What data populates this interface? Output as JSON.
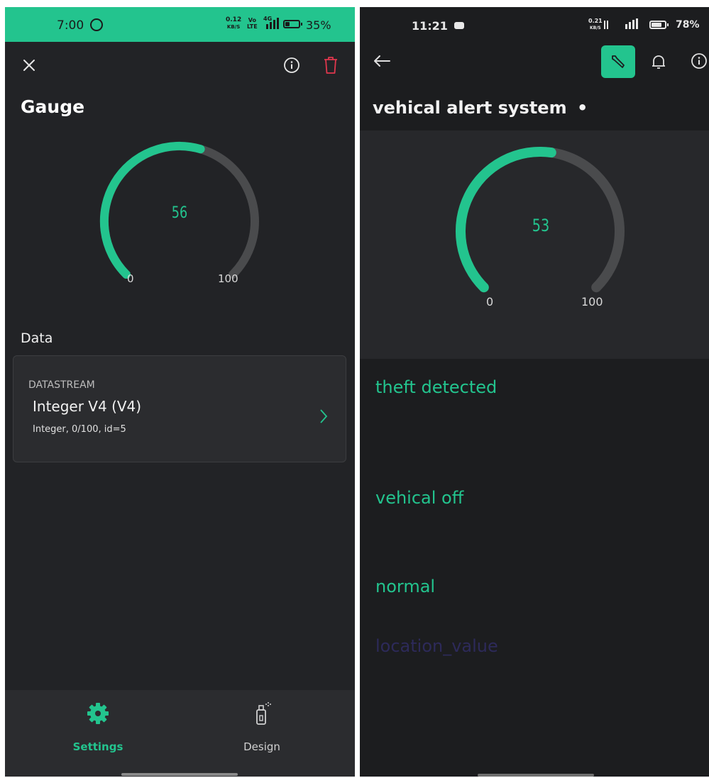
{
  "colors": {
    "accent": "#23c48e",
    "track": "#4a4b4d",
    "status_bar_left": "#23c48e",
    "panel_bg": "#222326",
    "delete_red": "#e0374d",
    "faded_text": "#2d2a5a"
  },
  "left": {
    "status_bar": {
      "time": "7:00",
      "speed_top": "0.12",
      "speed_bottom": "KB/S",
      "net_top": "Vo",
      "net_bottom": "LTE",
      "net2": "4G",
      "battery": "35%",
      "battery_level": 0.35
    },
    "header": {
      "close_icon": "close-icon",
      "info_icon": "info-icon",
      "delete_icon": "trash-icon"
    },
    "title": "Gauge",
    "gauge": {
      "value": 56,
      "min": 0,
      "max": 100,
      "value_text": "56",
      "min_label": "0",
      "max_label": "100"
    },
    "section_title": "Data",
    "datastream": {
      "label": "DATASTREAM",
      "name": "Integer V4 (V4)",
      "details": "Integer, 0/100, id=5"
    },
    "bottom_nav": [
      {
        "label": "Settings",
        "icon": "gear-icon",
        "active": true
      },
      {
        "label": "Design",
        "icon": "spray-can-icon",
        "active": false
      }
    ]
  },
  "right": {
    "status_bar": {
      "time": "11:21",
      "speed_top": "0.21",
      "speed_bottom": "KB/S",
      "battery": "78%",
      "battery_level": 0.78
    },
    "header": {
      "back_icon": "arrow-left-icon",
      "wrench_icon": "wrench-icon",
      "bell_icon": "bell-icon",
      "info_icon": "info-icon"
    },
    "title": "vehical alert system",
    "title_dot": "•",
    "gauge": {
      "value": 53,
      "min": 0,
      "max": 100,
      "value_text": "53",
      "min_label": "0",
      "max_label": "100"
    },
    "labels": [
      "theft detected",
      "vehical off",
      "normal",
      "location_value"
    ]
  }
}
